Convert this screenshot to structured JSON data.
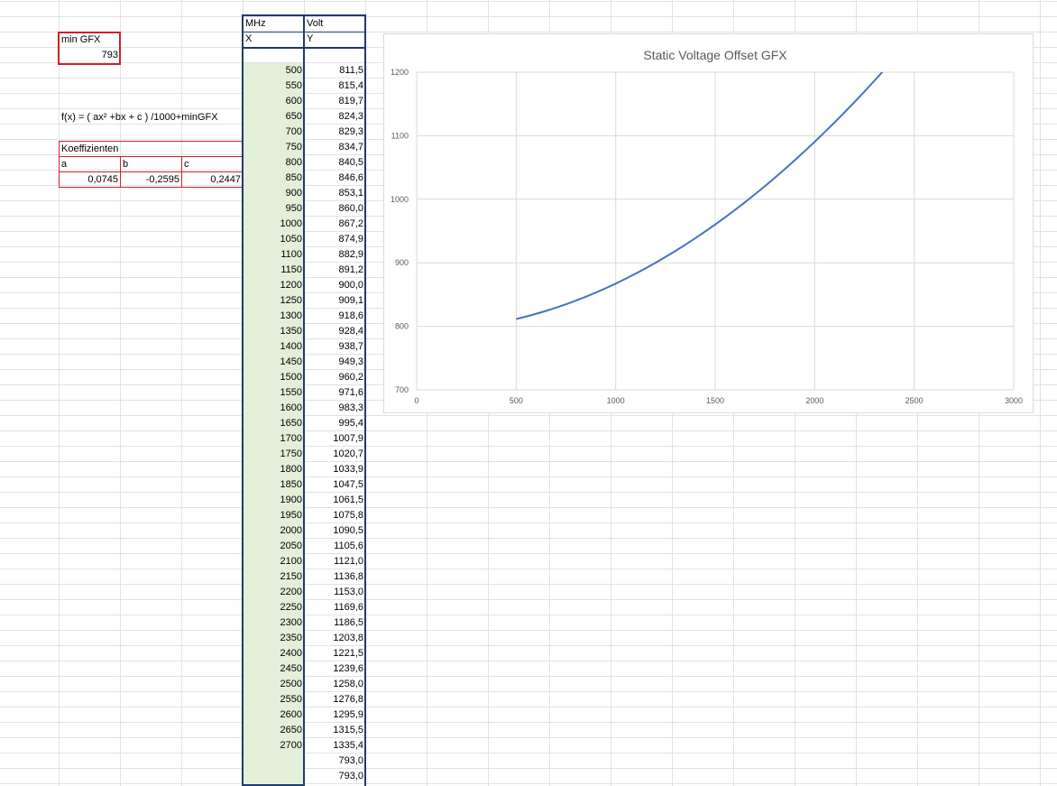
{
  "sheet": {
    "min_gfx_label": "min GFX",
    "min_gfx_value": "793",
    "formula": "f(x) = ( ax² +bx + c ) /1000+minGFX",
    "koeff_label": "Koeffizienten",
    "coef_headers": [
      "a",
      "b",
      "c"
    ],
    "coef_values": [
      "0,0745",
      "-0,2595",
      "0,2447"
    ],
    "col_x_header": "MHz",
    "col_y_header": "Volt",
    "col_x_sub": "X",
    "col_y_sub": "Y"
  },
  "table": {
    "x": [
      "500",
      "550",
      "600",
      "650",
      "700",
      "750",
      "800",
      "850",
      "900",
      "950",
      "1000",
      "1050",
      "1100",
      "1150",
      "1200",
      "1250",
      "1300",
      "1350",
      "1400",
      "1450",
      "1500",
      "1550",
      "1600",
      "1650",
      "1700",
      "1750",
      "1800",
      "1850",
      "1900",
      "1950",
      "2000",
      "2050",
      "2100",
      "2150",
      "2200",
      "2250",
      "2300",
      "2350",
      "2400",
      "2450",
      "2500",
      "2550",
      "2600",
      "2650",
      "2700",
      "",
      ""
    ],
    "y": [
      "811,5",
      "815,4",
      "819,7",
      "824,3",
      "829,3",
      "834,7",
      "840,5",
      "846,6",
      "853,1",
      "860,0",
      "867,2",
      "874,9",
      "882,9",
      "891,2",
      "900,0",
      "909,1",
      "918,6",
      "928,4",
      "938,7",
      "949,3",
      "960,2",
      "971,6",
      "983,3",
      "995,4",
      "1007,9",
      "1020,7",
      "1033,9",
      "1047,5",
      "1061,5",
      "1075,8",
      "1090,5",
      "1105,6",
      "1121,0",
      "1136,8",
      "1153,0",
      "1169,6",
      "1186,5",
      "1203,8",
      "1221,5",
      "1239,6",
      "1258,0",
      "1276,8",
      "1295,9",
      "1315,5",
      "1335,4",
      "793,0",
      "793,0"
    ]
  },
  "chart_data": {
    "type": "line",
    "title": "Static Voltage Offset GFX",
    "xlabel": "",
    "ylabel": "",
    "xlim": [
      0,
      3000
    ],
    "ylim": [
      700,
      1200
    ],
    "x_ticks": [
      "0",
      "500",
      "1000",
      "1500",
      "2000",
      "2500",
      "3000"
    ],
    "y_ticks": [
      "700",
      "800",
      "900",
      "1000",
      "1100",
      "1200"
    ],
    "grid": true,
    "line_color": "#4472c4",
    "series": [
      {
        "x": [
          500,
          550,
          600,
          650,
          700,
          750,
          800,
          850,
          900,
          950,
          1000,
          1050,
          1100,
          1150,
          1200,
          1250,
          1300,
          1350,
          1400,
          1450,
          1500,
          1550,
          1600,
          1650,
          1700,
          1750,
          1800,
          1850,
          1900,
          1950,
          2000,
          2050,
          2100,
          2150,
          2200,
          2250,
          2300,
          2350,
          2400,
          2450,
          2500,
          2550,
          2600,
          2650,
          2700
        ],
        "values": [
          811.5,
          815.4,
          819.7,
          824.3,
          829.3,
          834.7,
          840.5,
          846.6,
          853.1,
          860.0,
          867.2,
          874.9,
          882.9,
          891.2,
          900.0,
          909.1,
          918.6,
          928.4,
          938.7,
          949.3,
          960.2,
          971.6,
          983.3,
          995.4,
          1007.9,
          1020.7,
          1033.9,
          1047.5,
          1061.5,
          1075.8,
          1090.5,
          1105.6,
          1121.0,
          1136.8,
          1153.0,
          1169.6,
          1186.5,
          1203.8,
          1221.5,
          1239.6,
          1258.0,
          1276.8,
          1295.9,
          1315.5,
          1335.4
        ]
      }
    ]
  }
}
